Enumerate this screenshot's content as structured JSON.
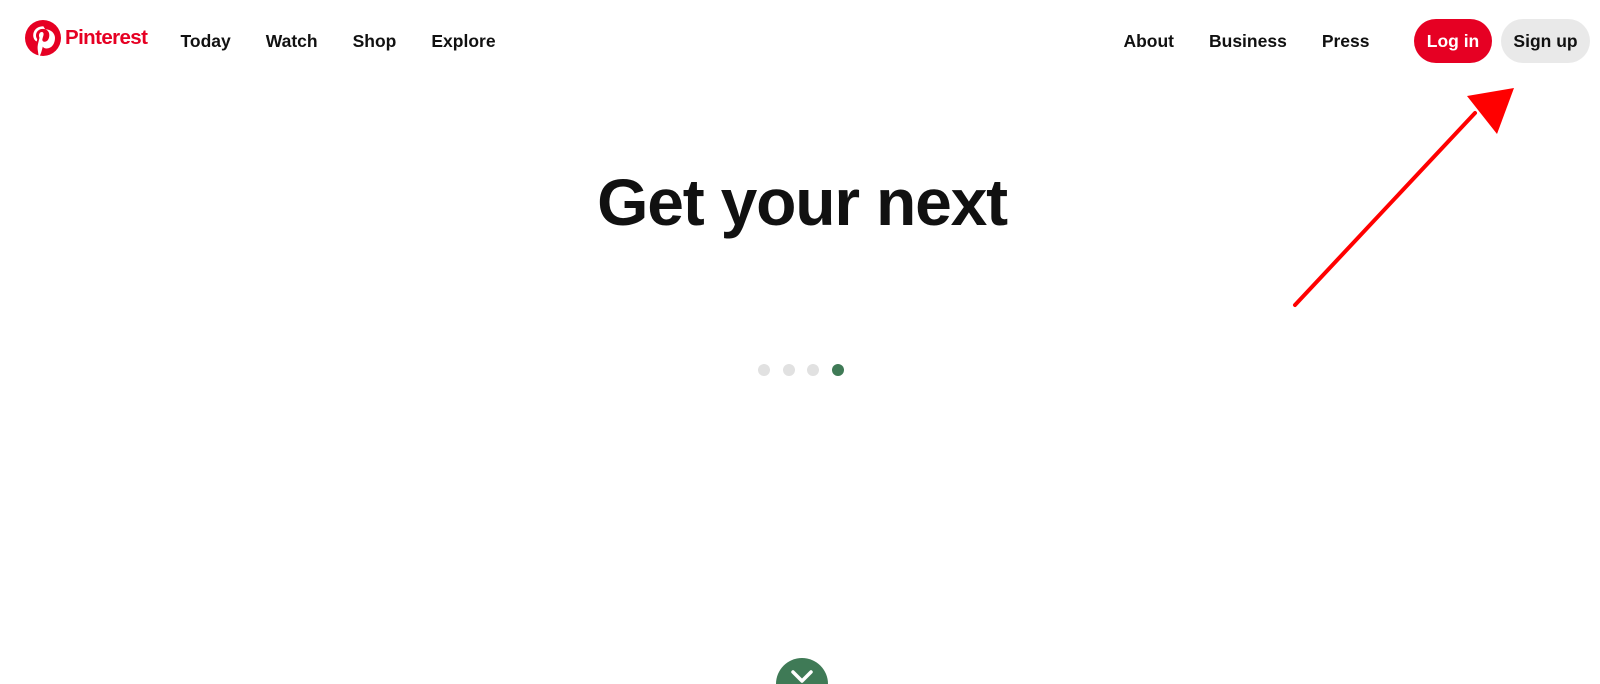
{
  "header": {
    "logo": {
      "text": "Pinterest",
      "icon": "pinterest-logo-icon",
      "color": "#e60023"
    },
    "nav_left": [
      {
        "label": "Today"
      },
      {
        "label": "Watch"
      },
      {
        "label": "Shop"
      },
      {
        "label": "Explore"
      }
    ],
    "nav_right": [
      {
        "label": "About"
      },
      {
        "label": "Business"
      },
      {
        "label": "Press"
      }
    ],
    "login_label": "Log in",
    "signup_label": "Sign up",
    "login_color": "#e60023",
    "signup_color": "#e9e9e9"
  },
  "hero": {
    "title": "Get your next",
    "carousel": {
      "total": 4,
      "active_index": 4,
      "active_color": "#3f7a56",
      "inactive_color": "#e1e1e1"
    },
    "scroll_button_icon": "chevron-down-icon"
  },
  "annotation": {
    "arrow_color": "#ff0000",
    "icon": "red-arrow-annotation"
  }
}
